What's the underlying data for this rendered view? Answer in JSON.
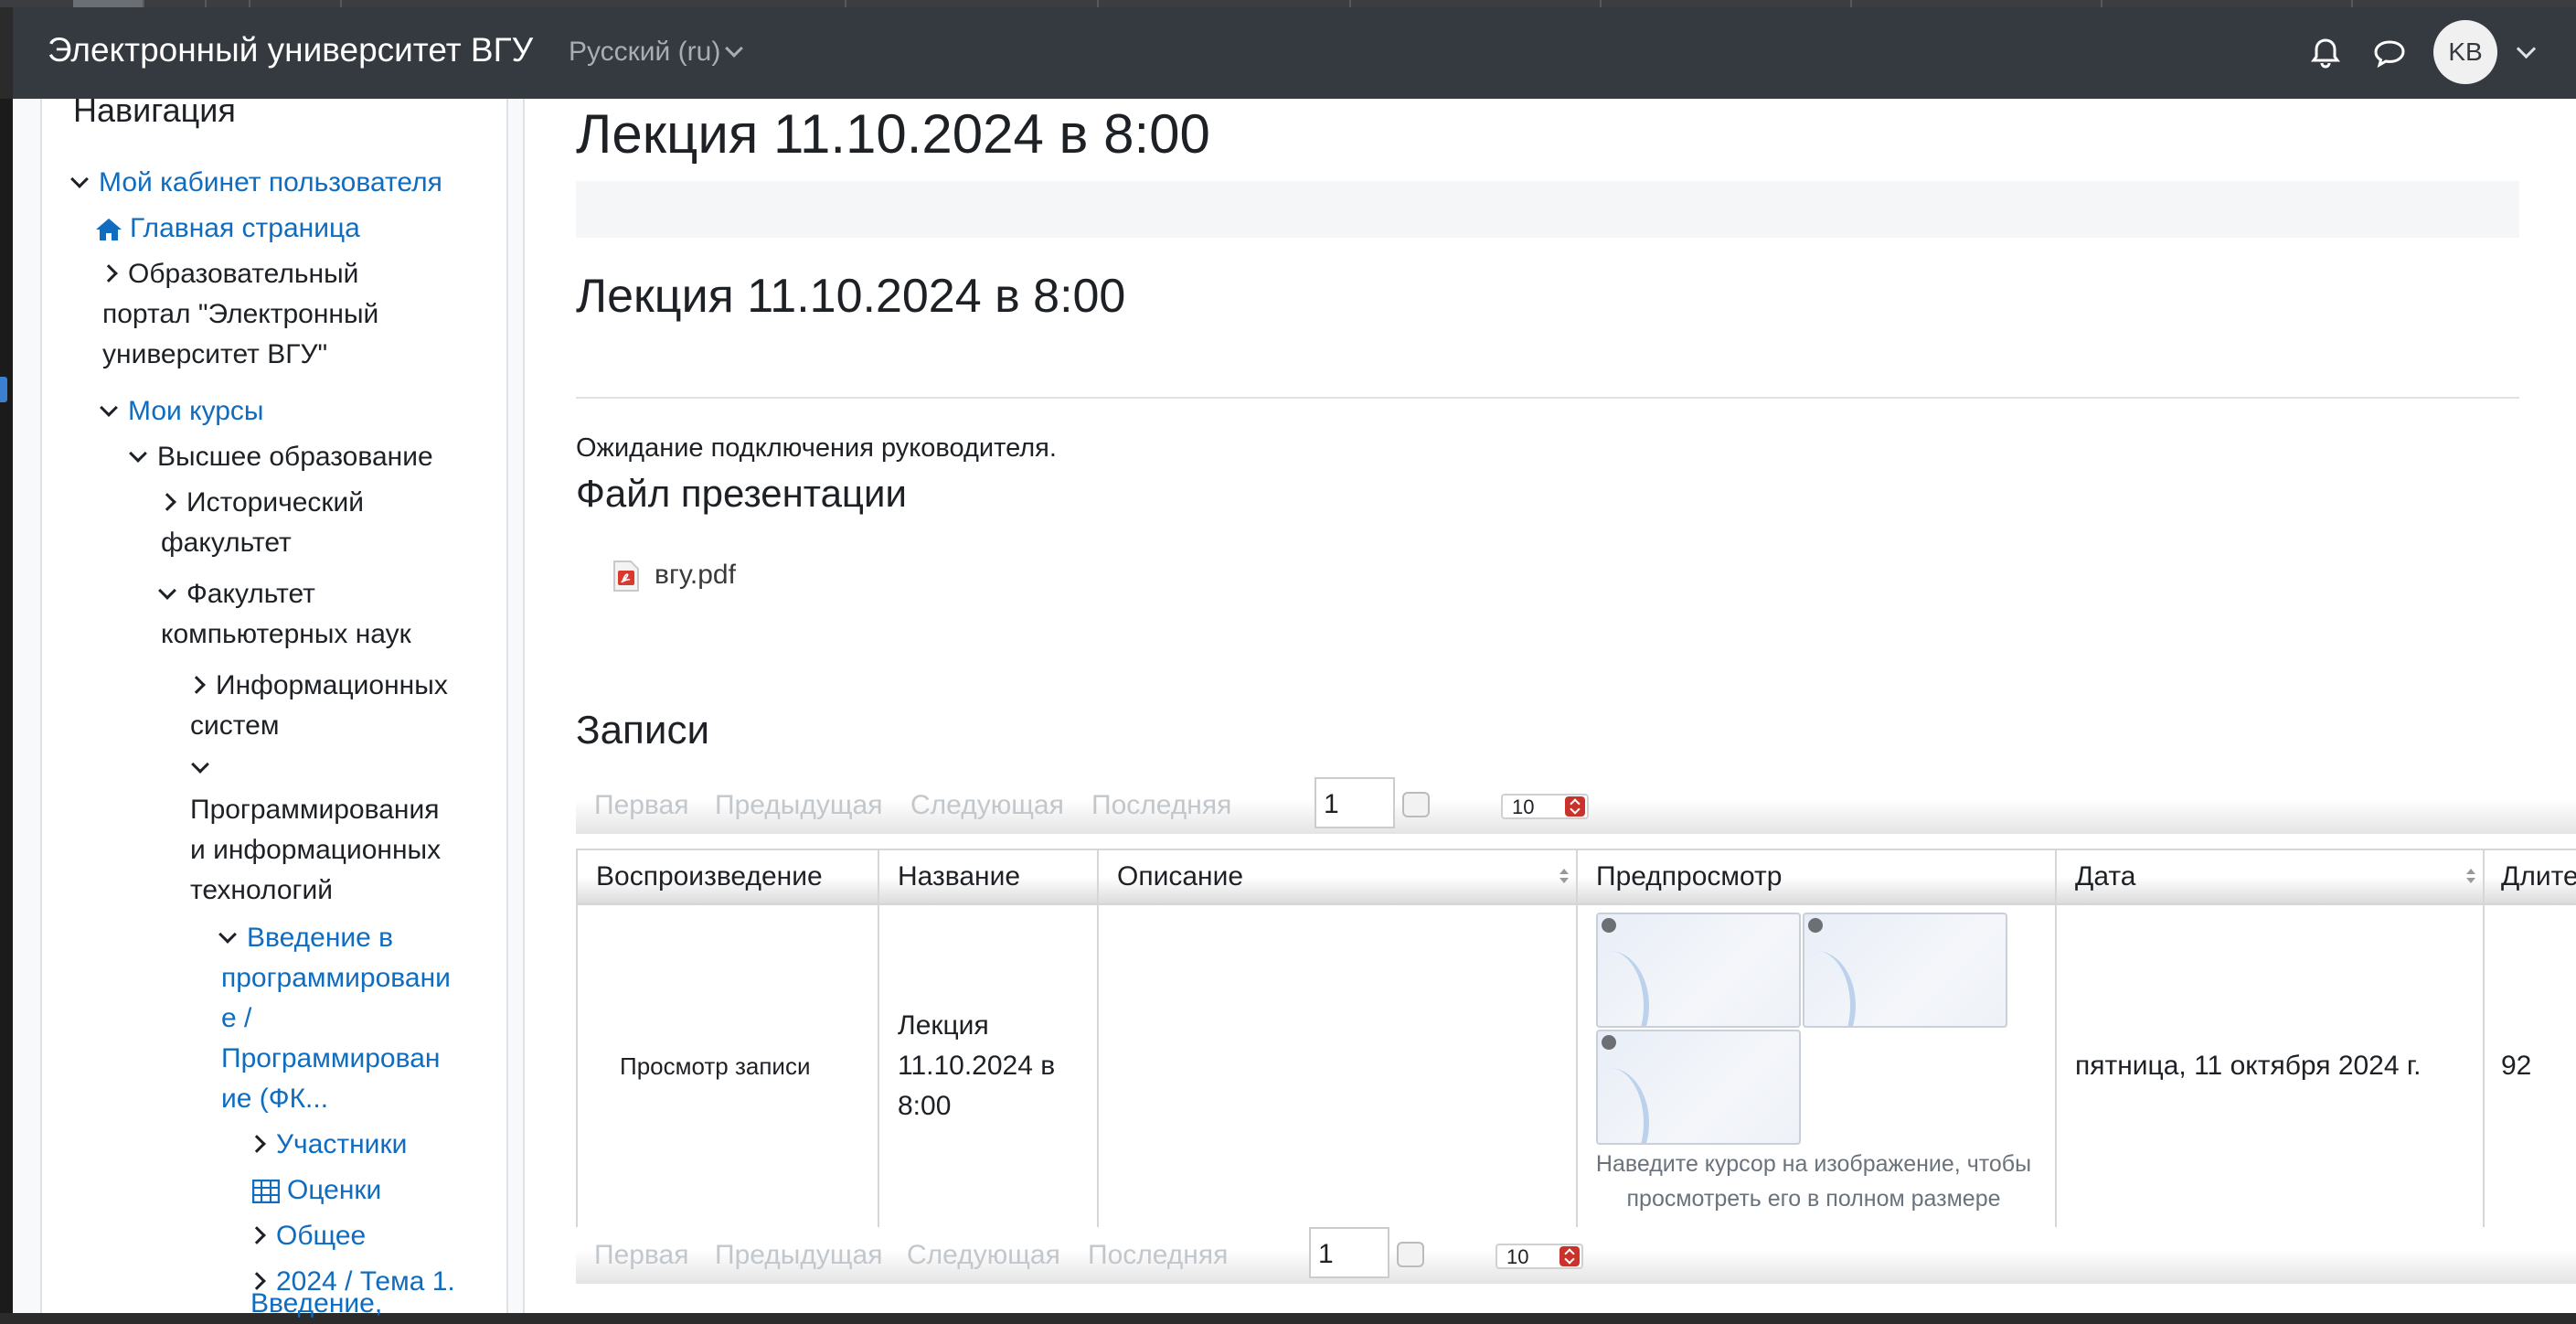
{
  "navbar": {
    "brand": "Электронный университет ВГУ",
    "language": "Русский (ru)",
    "avatar_initials": "KB"
  },
  "sidebar": {
    "title": "Навигация",
    "items": [
      {
        "label": "Мой кабинет пользователя"
      },
      {
        "label": "Главная страница"
      },
      {
        "label": "Образовательный"
      },
      {
        "label": "портал \"Электронный"
      },
      {
        "label": "университет ВГУ\""
      },
      {
        "label": "Мои курсы"
      },
      {
        "label": "Высшее образование"
      },
      {
        "label": "Исторический"
      },
      {
        "label": "факультет"
      },
      {
        "label": "Факультет"
      },
      {
        "label": "компьютерных наук"
      },
      {
        "label": "Информационных"
      },
      {
        "label": "систем"
      },
      {
        "label": "Программирования"
      },
      {
        "label": "и информационных"
      },
      {
        "label": "технологий"
      },
      {
        "label": "Введение в"
      },
      {
        "label": "программировани"
      },
      {
        "label": "е /"
      },
      {
        "label": "Программирован"
      },
      {
        "label": "ие (ФК..."
      },
      {
        "label": "Участники"
      },
      {
        "label": "Оценки"
      },
      {
        "label": "Общее"
      },
      {
        "label": "2024 / Тема 1."
      },
      {
        "label": "Введение,"
      }
    ]
  },
  "main": {
    "page_heading": "Лекция 11.10.2024 в 8:00",
    "room_heading": "Лекция 11.10.2024 в 8:00",
    "status_text": "Ожидание подключения руководителя.",
    "presentation_heading": "Файл презентации",
    "presentation_file": "вгу.pdf",
    "recordings_heading": "Записи"
  },
  "pager": {
    "first": "Первая",
    "prev": "Предыдущая",
    "next": "Следующая",
    "last": "Последняя",
    "page_value": "1",
    "page_size": "10"
  },
  "table": {
    "headers": [
      "Воспроизведение",
      "Название",
      "Описание",
      "Предпросмотр",
      "Дата",
      "Длител"
    ],
    "row": {
      "playback": "Просмотр записи",
      "name_lines": [
        "Лекция",
        "11.10.2024 в",
        "8:00"
      ],
      "description": "",
      "preview_hint_lines": [
        "Наведите курсор на изображение, чтобы",
        "просмотреть его в полном размере"
      ],
      "date": "пятница, 11 октября 2024 г.",
      "duration": "92"
    }
  },
  "colors": {
    "navbar": "#343a40",
    "link": "#0f6cbf",
    "spinner_red": "#c9332c"
  }
}
